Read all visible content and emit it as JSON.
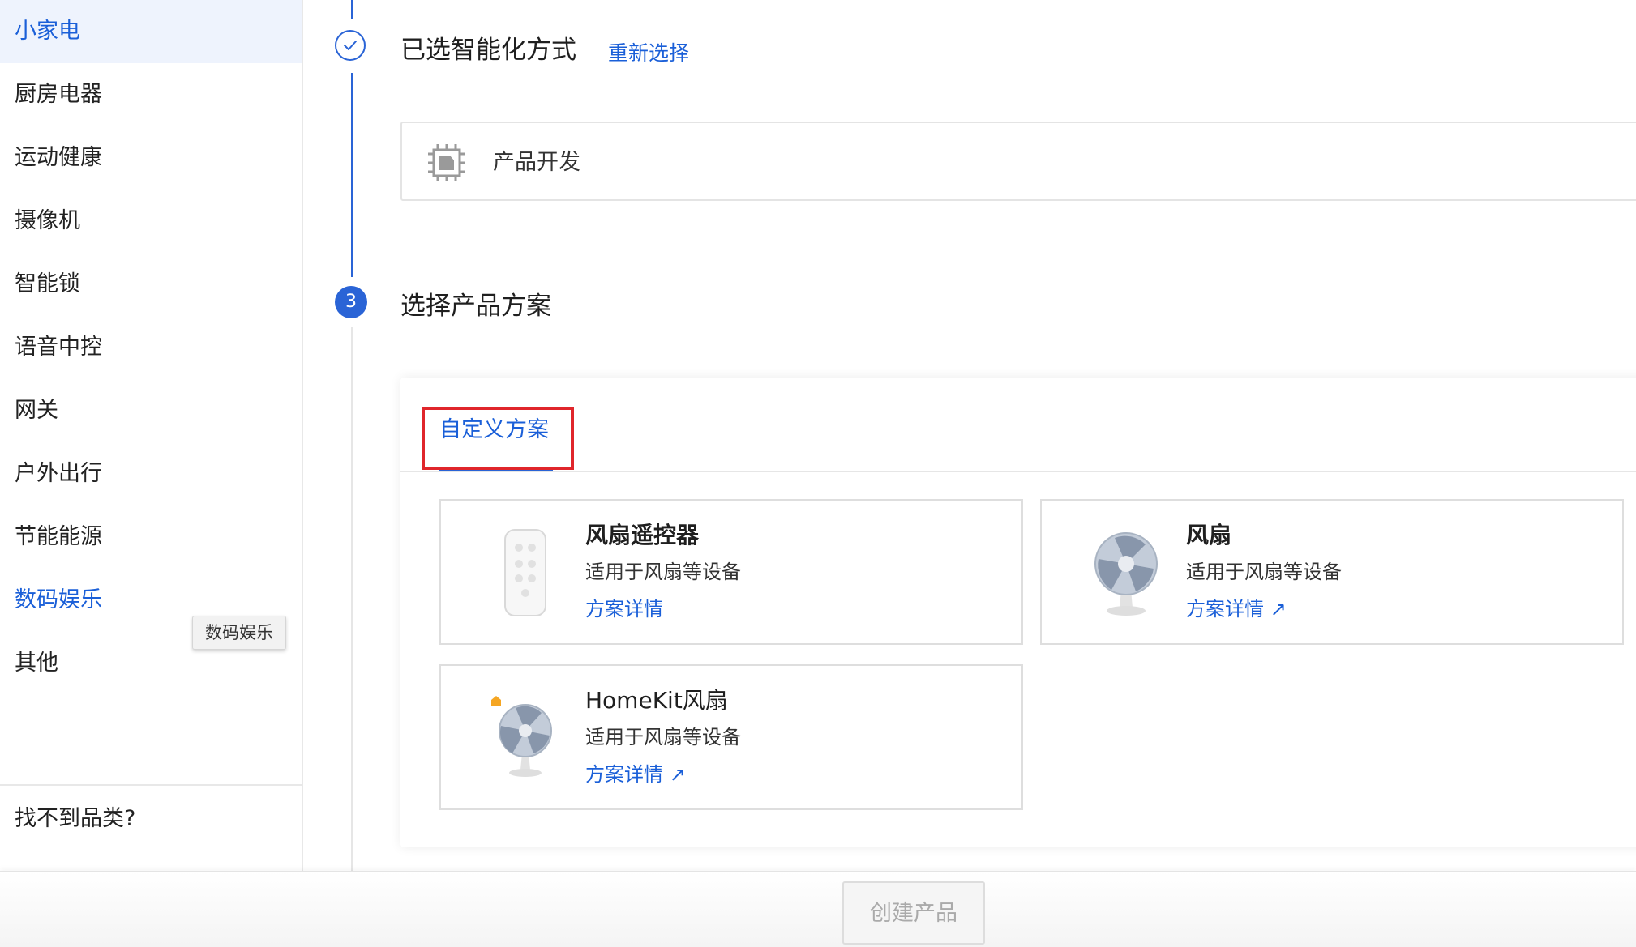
{
  "sidebar": {
    "items": [
      {
        "label": "小家电"
      },
      {
        "label": "厨房电器"
      },
      {
        "label": "运动健康"
      },
      {
        "label": "摄像机"
      },
      {
        "label": "智能锁"
      },
      {
        "label": "语音中控"
      },
      {
        "label": "网关"
      },
      {
        "label": "户外出行"
      },
      {
        "label": "节能能源"
      },
      {
        "label": "数码娱乐"
      },
      {
        "label": "其他"
      }
    ],
    "active_item": "小家电",
    "hovered_item": "数码娱乐",
    "tooltip": "数码娱乐",
    "footer": "找不到品类?"
  },
  "step_done": {
    "title": "已选智能化方式",
    "reselect_link": "重新选择",
    "selected_method": "产品开发",
    "method_icon": "chip-icon",
    "status_icon": "check-circle-icon"
  },
  "step3": {
    "number": "3",
    "title": "选择产品方案",
    "tab": "自定义方案",
    "cards": [
      {
        "title": "风扇遥控器",
        "desc": "适用于风扇等设备",
        "link": "方案详情",
        "external": false,
        "image": "remote-control-image"
      },
      {
        "title": "风扇",
        "desc": "适用于风扇等设备",
        "link": "方案详情",
        "external": true,
        "image": "fan-image"
      },
      {
        "title": "HomeKit风扇",
        "desc": "适用于风扇等设备",
        "link": "方案详情",
        "external": true,
        "image": "homekit-fan-image"
      }
    ]
  },
  "footer": {
    "create_button": "创建产品",
    "create_button_enabled": false
  },
  "colors": {
    "accent": "#2a64d6",
    "active_bg": "#eef3fd",
    "highlight_frame": "#e0262b"
  }
}
